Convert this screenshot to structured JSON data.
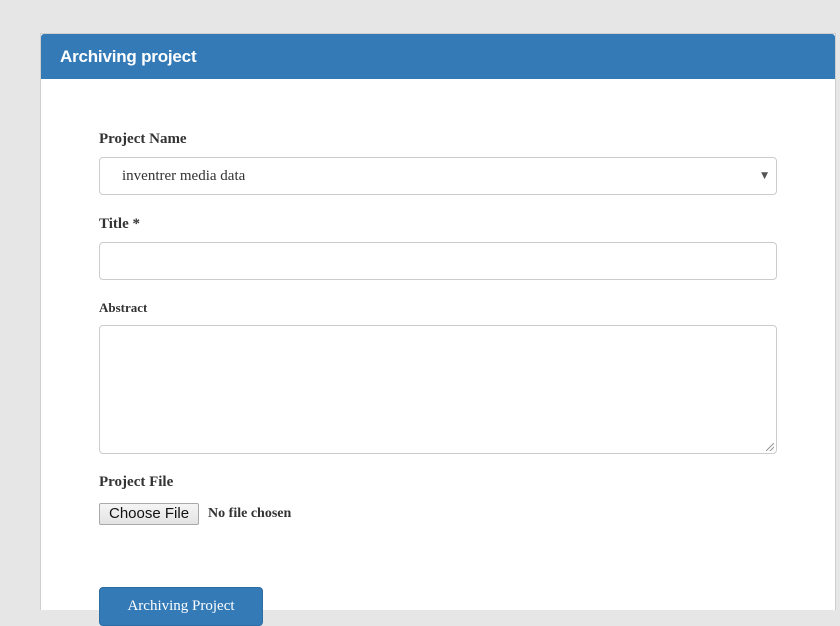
{
  "panel": {
    "title": "Archiving project",
    "accent_color": "#337ab7"
  },
  "form": {
    "project_name": {
      "label": "Project Name",
      "selected_value": "inventrer media data",
      "icon": "caret-down-icon"
    },
    "title": {
      "label": "Title *",
      "value": ""
    },
    "abstract": {
      "label": "Abstract",
      "value": ""
    },
    "project_file": {
      "label": "Project File",
      "button_label": "Choose File",
      "status": "No file chosen"
    },
    "submit_label": "Archiving Project"
  }
}
